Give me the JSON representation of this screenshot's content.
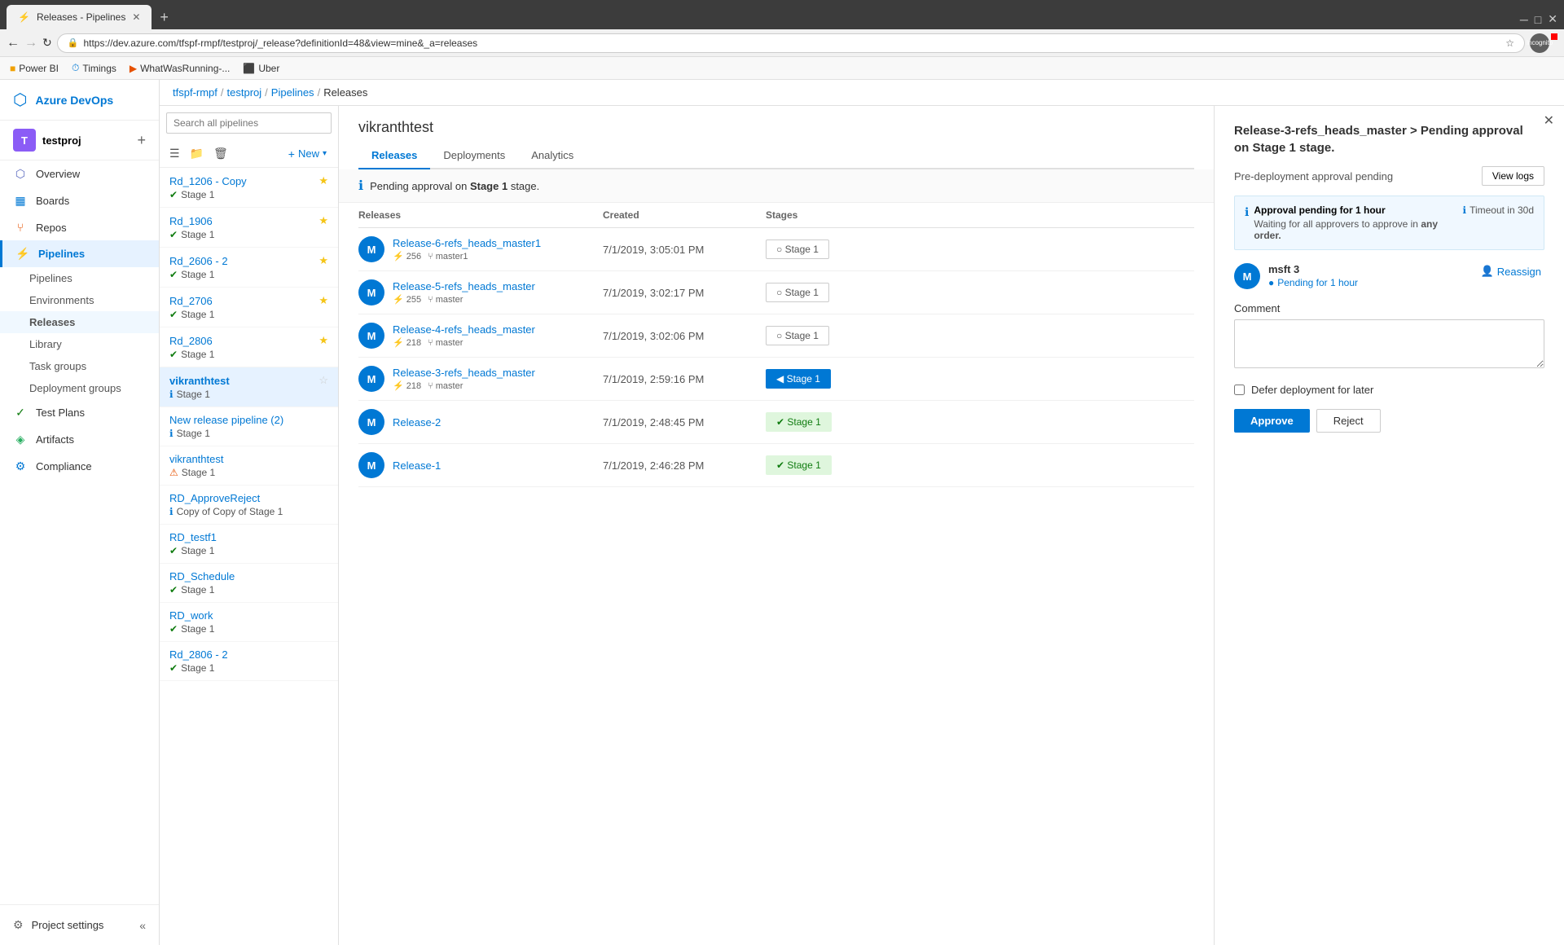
{
  "browser": {
    "tab_title": "Releases - Pipelines",
    "url": "https://dev.azure.com/tfspf-rmpf/testproj/_release?definitionId=48&view=mine&_a=releases",
    "bookmarks": [
      "Power BI",
      "Timings",
      "WhatWasRunning...",
      "Uber"
    ],
    "incognito_label": "Incognito"
  },
  "breadcrumb": {
    "items": [
      "tfspf-rmpf",
      "testproj",
      "Pipelines",
      "Releases"
    ]
  },
  "sidebar": {
    "logo_text": "Azure DevOps",
    "org_name": "testproj",
    "org_initial": "T",
    "nav_items": [
      {
        "id": "overview",
        "label": "Overview",
        "icon": "⬡"
      },
      {
        "id": "boards",
        "label": "Boards",
        "icon": "▦"
      },
      {
        "id": "repos",
        "label": "Repos",
        "icon": "🔀"
      },
      {
        "id": "pipelines",
        "label": "Pipelines",
        "icon": "⚡",
        "active": true
      },
      {
        "id": "pipelines-sub",
        "label": "Pipelines",
        "icon": ""
      },
      {
        "id": "environments",
        "label": "Environments",
        "icon": ""
      },
      {
        "id": "releases",
        "label": "Releases",
        "icon": ""
      },
      {
        "id": "library",
        "label": "Library",
        "icon": ""
      },
      {
        "id": "taskgroups",
        "label": "Task groups",
        "icon": ""
      },
      {
        "id": "deploymentgroups",
        "label": "Deployment groups",
        "icon": ""
      },
      {
        "id": "testplans",
        "label": "Test Plans",
        "icon": "✓"
      },
      {
        "id": "artifacts",
        "label": "Artifacts",
        "icon": "◈"
      },
      {
        "id": "compliance",
        "label": "Compliance",
        "icon": "⚙"
      }
    ],
    "footer": {
      "settings_label": "Project settings",
      "collapse_label": "Collapse"
    }
  },
  "pipeline_list": {
    "search_placeholder": "Search all pipelines",
    "new_btn_label": "New",
    "items": [
      {
        "id": 1,
        "name": "Rd_1206 - Copy",
        "stage": "Stage 1",
        "starred": true,
        "stage_status": "green"
      },
      {
        "id": 2,
        "name": "Rd_1906",
        "stage": "Stage 1",
        "starred": true,
        "stage_status": "green"
      },
      {
        "id": 3,
        "name": "Rd_2606 - 2",
        "stage": "Stage 1",
        "starred": true,
        "stage_status": "green"
      },
      {
        "id": 4,
        "name": "Rd_2706",
        "stage": "Stage 1",
        "starred": true,
        "stage_status": "green"
      },
      {
        "id": 5,
        "name": "Rd_2806",
        "stage": "Stage 1",
        "starred": true,
        "stage_status": "green"
      },
      {
        "id": 6,
        "name": "vikranthtest",
        "stage": "Stage 1",
        "starred": false,
        "stage_status": "blue",
        "active": true
      },
      {
        "id": 7,
        "name": "New release pipeline (2)",
        "stage": "Stage 1",
        "starred": false,
        "stage_status": "blue"
      },
      {
        "id": 8,
        "name": "vikranthtest",
        "stage": "Stage 1",
        "starred": false,
        "stage_status": "orange"
      },
      {
        "id": 9,
        "name": "RD_ApproveReject",
        "stage": "Copy of Copy of Stage 1",
        "starred": false,
        "stage_status": "blue"
      },
      {
        "id": 10,
        "name": "RD_testf1",
        "stage": "Stage 1",
        "starred": false,
        "stage_status": "green"
      },
      {
        "id": 11,
        "name": "RD_Schedule",
        "stage": "Stage 1",
        "starred": false,
        "stage_status": "green"
      },
      {
        "id": 12,
        "name": "RD_work",
        "stage": "Stage 1",
        "starred": false,
        "stage_status": "green"
      },
      {
        "id": 13,
        "name": "Rd_2806 - 2",
        "stage": "Stage 1",
        "starred": false,
        "stage_status": "green"
      }
    ]
  },
  "release_detail": {
    "title": "vikranthtest",
    "tabs": [
      {
        "id": "releases",
        "label": "Releases",
        "active": true
      },
      {
        "id": "deployments",
        "label": "Deployments"
      },
      {
        "id": "analytics",
        "label": "Analytics"
      }
    ],
    "pending_notice": "Pending approval on Stage 1 stage.",
    "table_headers": {
      "releases": "Releases",
      "created": "Created",
      "stages": "Stages"
    },
    "releases": [
      {
        "id": 1,
        "name": "Release-6-refs_heads_master1",
        "avatar": "M",
        "build_num": "256",
        "branch": "master1",
        "created": "7/1/2019, 3:05:01 PM",
        "stage": "Stage 1",
        "stage_type": "outline"
      },
      {
        "id": 2,
        "name": "Release-5-refs_heads_master",
        "avatar": "M",
        "build_num": "255",
        "branch": "master",
        "created": "7/1/2019, 3:02:17 PM",
        "stage": "Stage 1",
        "stage_type": "outline"
      },
      {
        "id": 3,
        "name": "Release-4-refs_heads_master",
        "avatar": "M",
        "build_num": "218",
        "branch": "master",
        "created": "7/1/2019, 3:02:06 PM",
        "stage": "Stage 1",
        "stage_type": "outline"
      },
      {
        "id": 4,
        "name": "Release-3-refs_heads_master",
        "avatar": "M",
        "build_num": "218",
        "branch": "master",
        "created": "7/1/2019, 2:59:16 PM",
        "stage": "Stage 1",
        "stage_type": "pending"
      },
      {
        "id": 5,
        "name": "Release-2",
        "avatar": "M",
        "build_num": "",
        "branch": "",
        "created": "7/1/2019, 2:48:45 PM",
        "stage": "Stage 1",
        "stage_type": "success"
      },
      {
        "id": 6,
        "name": "Release-1",
        "avatar": "M",
        "build_num": "",
        "branch": "",
        "created": "7/1/2019, 2:46:28 PM",
        "stage": "Stage 1",
        "stage_type": "success"
      }
    ]
  },
  "approval_panel": {
    "title": "Release-3-refs_heads_master > Pending approval on Stage 1 stage.",
    "subtitle": "Pre-deployment approval pending",
    "view_logs_label": "View logs",
    "approval_pending_label": "Approval pending for 1 hour",
    "approval_detail": "Waiting for all approvers to approve in any order.",
    "timeout_label": "Timeout in 30d",
    "approver_name": "msft 3",
    "approver_status": "Pending for 1 hour",
    "approver_initial": "M",
    "reassign_label": "Reassign",
    "comment_label": "Comment",
    "defer_label": "Defer deployment for later",
    "approve_label": "Approve",
    "reject_label": "Reject"
  }
}
